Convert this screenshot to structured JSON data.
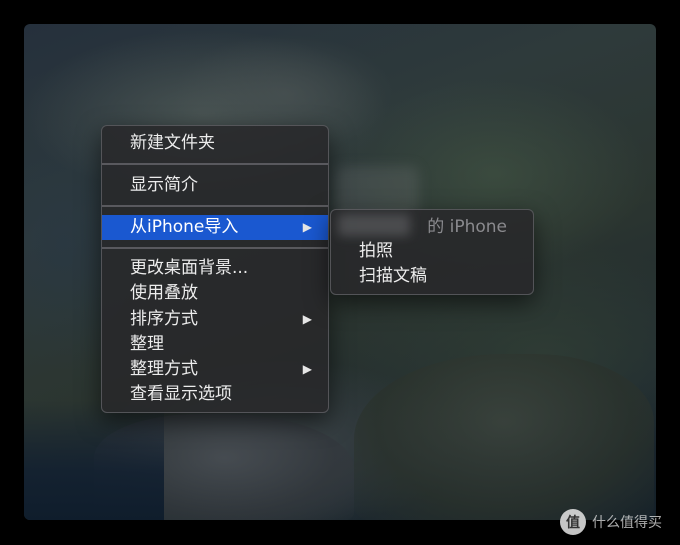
{
  "context_menu": {
    "items": [
      {
        "label": "新建文件夹",
        "has_submenu": false,
        "active": false
      },
      {
        "label": "显示简介",
        "has_submenu": false,
        "active": false
      },
      {
        "label": "从iPhone导入",
        "has_submenu": true,
        "active": true
      },
      {
        "label": "更改桌面背景...",
        "has_submenu": false,
        "active": false
      },
      {
        "label": "使用叠放",
        "has_submenu": false,
        "active": false
      },
      {
        "label": "排序方式",
        "has_submenu": true,
        "active": false
      },
      {
        "label": "整理",
        "has_submenu": false,
        "active": false
      },
      {
        "label": "整理方式",
        "has_submenu": true,
        "active": false
      },
      {
        "label": "查看显示选项",
        "has_submenu": false,
        "active": false
      }
    ],
    "submenu_arrow": "▶"
  },
  "submenu": {
    "header": "的 iPhone",
    "items": [
      {
        "label": "拍照"
      },
      {
        "label": "扫描文稿"
      }
    ]
  },
  "watermark": {
    "logo": "值",
    "text": "什么值得买"
  },
  "colors": {
    "menu_highlight": "#1a58d0",
    "menu_text": "#ececec",
    "disabled_text": "#8a8a8e"
  }
}
